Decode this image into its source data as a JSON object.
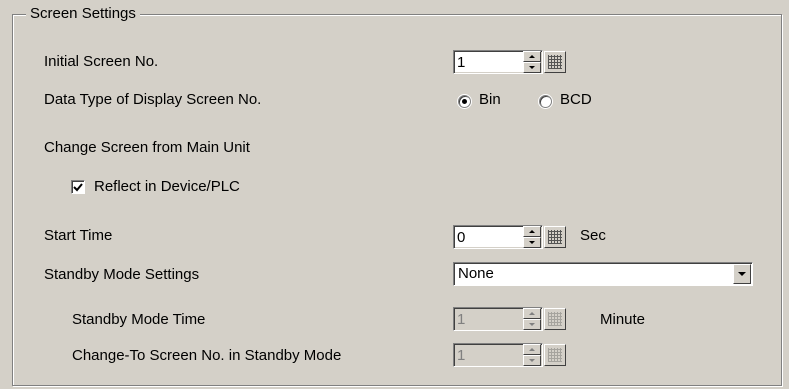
{
  "group": {
    "title": "Screen Settings"
  },
  "initial_screen": {
    "label": "Initial Screen No.",
    "value": "1"
  },
  "data_type": {
    "label": "Data Type of Display Screen No.",
    "options": [
      "Bin",
      "BCD"
    ],
    "selected": "Bin"
  },
  "change_screen": {
    "label": "Change Screen from Main Unit"
  },
  "reflect": {
    "label": "Reflect in Device/PLC",
    "checked": true
  },
  "start_time": {
    "label": "Start Time",
    "value": "0",
    "unit": "Sec"
  },
  "standby_mode": {
    "label": "Standby Mode Settings",
    "value": "None"
  },
  "standby_time": {
    "label": "Standby Mode Time",
    "value": "1",
    "unit": "Minute",
    "disabled": true
  },
  "change_to_screen": {
    "label": "Change-To Screen No. in Standby Mode",
    "value": "1",
    "disabled": true
  },
  "icons": {
    "spin": "spin-updown-icon",
    "keypad": "keypad-grid-icon",
    "dropdown": "chevron-down-icon"
  }
}
